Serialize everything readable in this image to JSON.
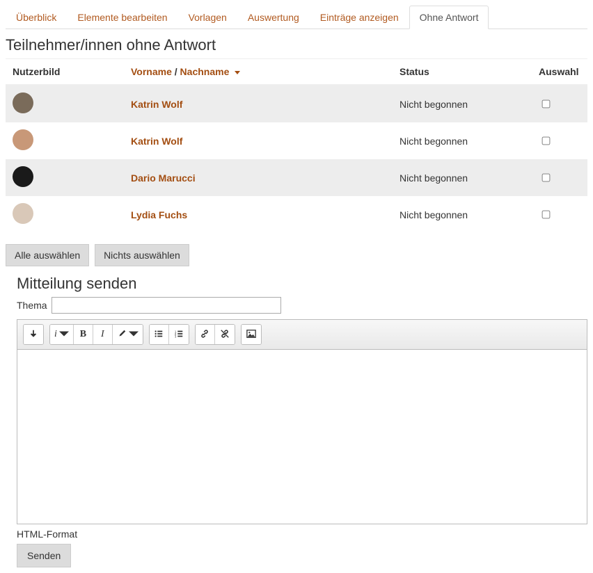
{
  "tabs": [
    {
      "label": "Überblick",
      "active": false
    },
    {
      "label": "Elemente bearbeiten",
      "active": false
    },
    {
      "label": "Vorlagen",
      "active": false
    },
    {
      "label": "Auswertung",
      "active": false
    },
    {
      "label": "Einträge anzeigen",
      "active": false
    },
    {
      "label": "Ohne Antwort",
      "active": true
    }
  ],
  "page_title": "Teilnehmer/innen ohne Antwort",
  "columns": {
    "picture": "Nutzerbild",
    "firstname": "Vorname",
    "separator": " / ",
    "lastname": "Nachname",
    "status": "Status",
    "select": "Auswahl"
  },
  "rows": [
    {
      "name": "Katrin Wolf",
      "status": "Nicht begonnen",
      "avatar_bg": "#7a6b5a"
    },
    {
      "name": "Katrin Wolf",
      "status": "Nicht begonnen",
      "avatar_bg": "#c89878"
    },
    {
      "name": "Dario Marucci",
      "status": "Nicht begonnen",
      "avatar_bg": "#1a1a1a"
    },
    {
      "name": "Lydia Fuchs",
      "status": "Nicht begonnen",
      "avatar_bg": "#d9c8b8"
    }
  ],
  "buttons": {
    "select_all": "Alle auswählen",
    "select_none": "Nichts auswählen"
  },
  "message": {
    "heading": "Mitteilung senden",
    "subject_label": "Thema",
    "format_label": "HTML-Format",
    "send_label": "Senden"
  }
}
